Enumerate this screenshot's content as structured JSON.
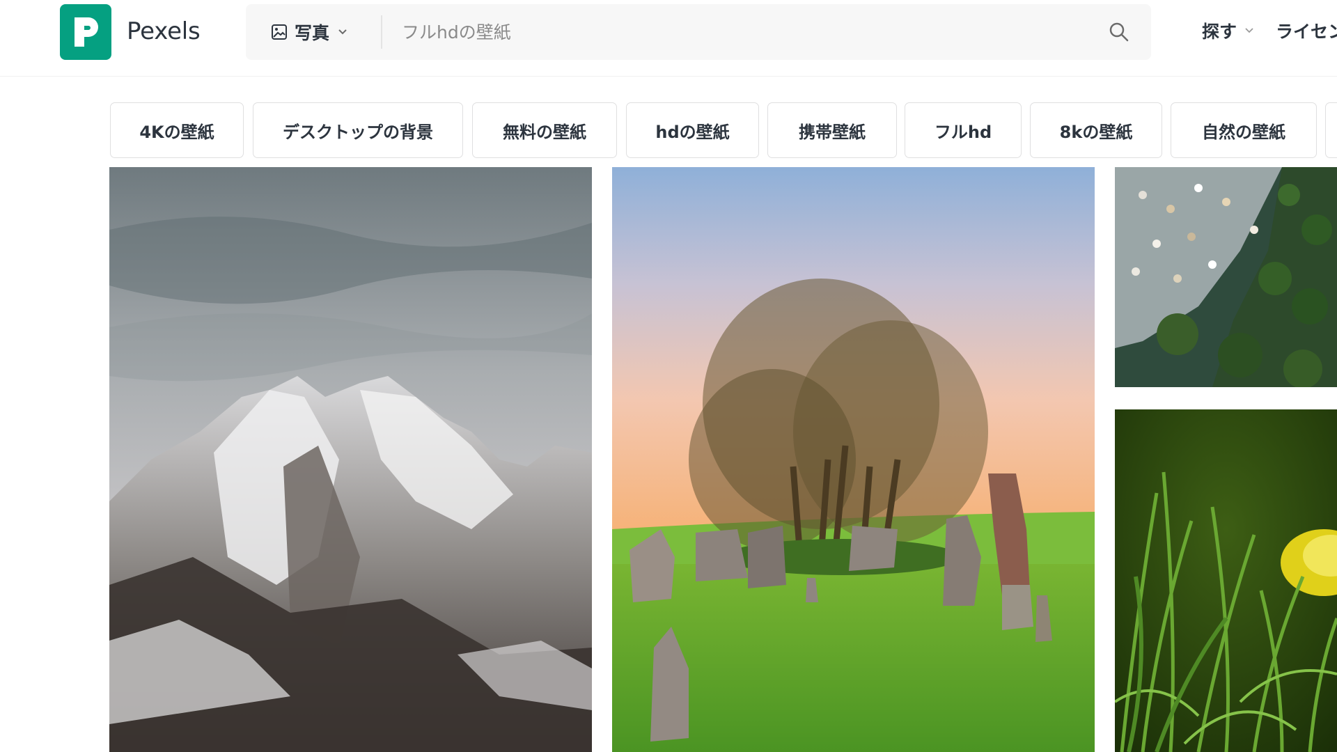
{
  "brand": {
    "name": "Pexels",
    "logo_letter": "P",
    "accent_color": "#05a081"
  },
  "search": {
    "media_type": "写真",
    "placeholder": "フルhdの壁紙",
    "icon": "search-icon"
  },
  "nav": {
    "explore": "探す",
    "license": "ライセン"
  },
  "tags": [
    "4Kの壁紙",
    "デスクトップの背景",
    "無料の壁紙",
    "hdの壁紙",
    "携帯壁紙",
    "フルhd",
    "8kの壁紙",
    "自然の壁紙"
  ],
  "photos": [
    {
      "subject": "snowy mountain peaks under cloudy sky"
    },
    {
      "subject": "trees and standing stones at sunset"
    },
    {
      "subject": "aerial view of beach with umbrellas and trees"
    },
    {
      "subject": "green grass with yellow flower"
    }
  ]
}
